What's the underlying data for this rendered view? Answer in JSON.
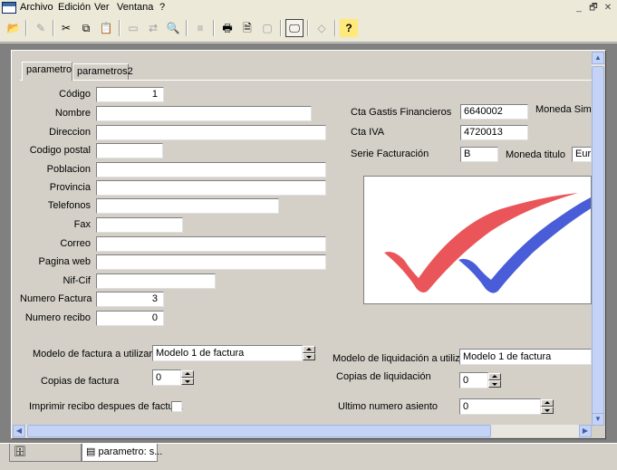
{
  "menu": {
    "items": [
      "Archivo",
      "Edición",
      "Ver",
      "Ventana",
      "?"
    ]
  },
  "window_controls": {
    "minimize": "_",
    "restore": "🗗",
    "close": "✕"
  },
  "toolbar": {
    "buttons": [
      {
        "icon": "open-folder-icon",
        "glyph": "📂"
      },
      {
        "icon": "edit-document-icon",
        "glyph": "✎"
      },
      {
        "icon": "cut-icon",
        "glyph": "✂"
      },
      {
        "icon": "copy-icon",
        "glyph": "⧉"
      },
      {
        "icon": "paste-icon",
        "glyph": "📋"
      },
      {
        "icon": "window-icon",
        "glyph": "▭"
      },
      {
        "icon": "find-replace-icon",
        "glyph": "⇄"
      },
      {
        "icon": "search-icon",
        "glyph": "🔍"
      },
      {
        "icon": "list-icon",
        "glyph": "≡"
      },
      {
        "icon": "printer-icon",
        "glyph": "🖶"
      },
      {
        "icon": "print-preview-icon",
        "glyph": "🗎"
      },
      {
        "icon": "page-setup-icon",
        "glyph": "▢"
      },
      {
        "icon": "monitor-icon",
        "glyph": "🖵"
      },
      {
        "icon": "eraser-icon",
        "glyph": "◇"
      },
      {
        "icon": "help-icon",
        "glyph": "?"
      }
    ]
  },
  "tabs": [
    "parametro",
    "parametros2"
  ],
  "form": {
    "codigo": {
      "label": "Código",
      "value": "1"
    },
    "nombre": {
      "label": "Nombre",
      "value": ""
    },
    "direccion": {
      "label": "Direccion",
      "value": ""
    },
    "codigo_postal": {
      "label": "Codigo postal",
      "value": ""
    },
    "poblacion": {
      "label": "Poblacion",
      "value": ""
    },
    "provincia": {
      "label": "Provincia",
      "value": ""
    },
    "telefonos": {
      "label": "Telefonos",
      "value": ""
    },
    "fax": {
      "label": "Fax",
      "value": ""
    },
    "correo": {
      "label": "Correo",
      "value": ""
    },
    "pagina_web": {
      "label": "Pagina web",
      "value": ""
    },
    "nif_cif": {
      "label": "Nif-Cif",
      "value": ""
    },
    "numero_factura": {
      "label": "Numero Factura",
      "value": "3"
    },
    "numero_recibo": {
      "label": "Numero recibo",
      "value": "0"
    },
    "cta_gastos": {
      "label": "Cta Gastis Financieros",
      "value": "6640002"
    },
    "moneda_simbolo": {
      "label": "Moneda Simbo"
    },
    "cta_iva": {
      "label": "Cta IVA",
      "value": "4720013"
    },
    "serie_facturacion": {
      "label": "Serie Facturación",
      "value": "B"
    },
    "moneda_titulo": {
      "label": "Moneda titulo",
      "value": "Euro"
    },
    "modelo_factura": {
      "label": "Modelo de factura a utilizar",
      "value": "Modelo 1 de factura"
    },
    "modelo_liquidacion": {
      "label": "Modelo de liquidación a utilizar",
      "value": "Modelo 1 de factura"
    },
    "copias_factura": {
      "label": "Copias de factura",
      "value": "0"
    },
    "copias_liquidacion": {
      "label": "Copias de liquidación",
      "value": "0"
    },
    "imprimir_recibo": {
      "label": "Imprimir recibo despues de factura",
      "checked": false
    },
    "ultimo_asiento": {
      "label": "Ultimo numero asiento",
      "value": "0"
    }
  },
  "logo": {
    "colors": {
      "left_check": "#e8474c",
      "right_check": "#3a4fd6"
    }
  },
  "bottom_tabs": [
    {
      "label": ""
    },
    {
      "label": "parametro: s..."
    }
  ],
  "colors": {
    "face": "#d4d0c8",
    "mdi_background": "#808080",
    "scrollbar": "#c4d3f5"
  }
}
